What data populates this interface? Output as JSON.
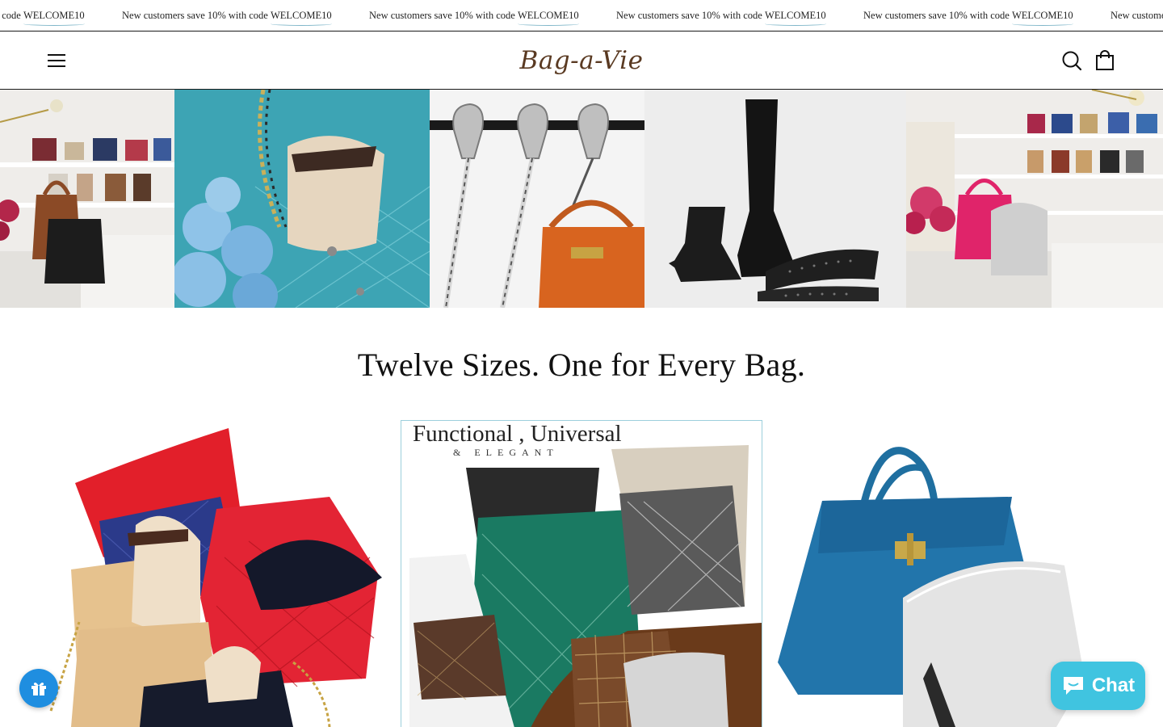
{
  "announcement": {
    "prefix": "New customers save 10% with code ",
    "code": "WELCOME10",
    "repeats": 6
  },
  "header": {
    "logo_text": "Bag-a-Vie",
    "menu_icon": "hamburger-menu-icon",
    "search_icon": "search-icon",
    "cart_icon": "shopping-bag-icon"
  },
  "hero": {
    "panels": [
      {
        "name": "closet-display-left"
      },
      {
        "name": "blue-quilted-bag-roses"
      },
      {
        "name": "bag-hangers"
      },
      {
        "name": "boot-shapers"
      },
      {
        "name": "closet-display-right"
      }
    ]
  },
  "section": {
    "title": "Twelve Sizes. One for Every Bag."
  },
  "products": {
    "promo_title": "Functional , Universal",
    "promo_subtitle": "& ELEGANT"
  },
  "widgets": {
    "rewards_icon": "gift-icon",
    "chat_label": "Chat",
    "chat_icon": "chat-bubble-icon"
  },
  "colors": {
    "accent_underline": "#7fb6c9",
    "chat": "#40c4e0",
    "rewards": "#1f8ee0",
    "logo": "#5a3a22"
  }
}
